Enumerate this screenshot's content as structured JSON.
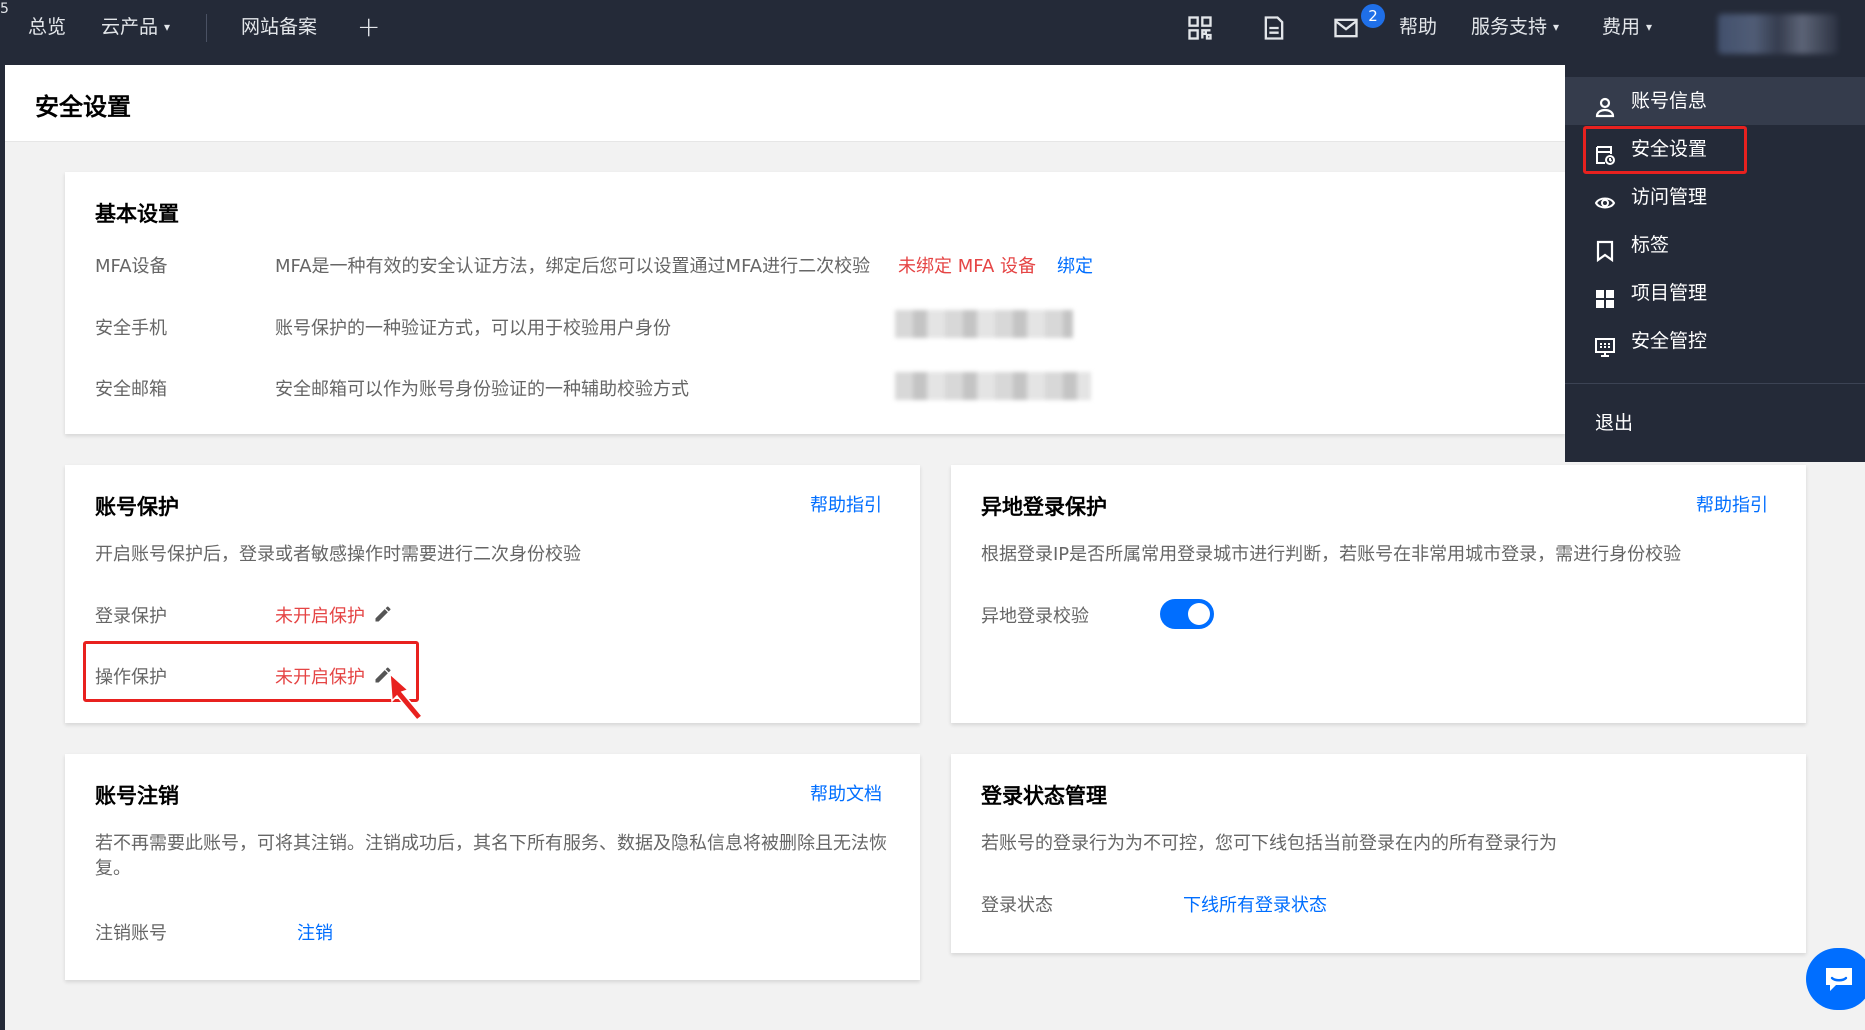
{
  "topbar": {
    "overview": "总览",
    "cloud_products": "云产品",
    "icp_filing": "网站备案",
    "add": "+",
    "message_count": "2",
    "help": "帮助",
    "service_support": "服务支持",
    "billing": "费用"
  },
  "page": {
    "title": "安全设置"
  },
  "basic_settings": {
    "title": "基本设置",
    "rows": [
      {
        "label": "MFA设备",
        "desc": "MFA是一种有效的安全认证方法，绑定后您可以设置通过MFA进行二次校验",
        "status": "未绑定 MFA 设备",
        "action": "绑定"
      },
      {
        "label": "安全手机",
        "desc": "账号保护的一种验证方式，可以用于校验用户身份"
      },
      {
        "label": "安全邮箱",
        "desc": "安全邮箱可以作为账号身份验证的一种辅助校验方式"
      }
    ]
  },
  "account_protection": {
    "title": "账号保护",
    "help_link": "帮助指引",
    "desc": "开启账号保护后，登录或者敏感操作时需要进行二次身份校验",
    "rows": [
      {
        "label": "登录保护",
        "status": "未开启保护"
      },
      {
        "label": "操作保护",
        "status": "未开启保护"
      }
    ]
  },
  "remote_login": {
    "title": "异地登录保护",
    "help_link": "帮助指引",
    "desc": "根据登录IP是否所属常用登录城市进行判断，若账号在非常用城市登录，需进行身份校验",
    "check_label": "异地登录校验",
    "enabled": true
  },
  "account_cancel": {
    "title": "账号注销",
    "help_link": "帮助文档",
    "desc_line1": "若不再需要此账号，可将其注销。注销成功后，其名下所有服务、数据及隐私信息将被删除且无法恢",
    "desc_line2": "复。",
    "label": "注销账号",
    "action": "注销"
  },
  "login_state": {
    "title": "登录状态管理",
    "desc": "若账号的登录行为为不可控，您可下线包括当前登录在内的所有登录行为",
    "label": "登录状态",
    "action": "下线所有登录状态"
  },
  "dropdown": {
    "items": [
      {
        "label": "账号信息",
        "icon": "user-icon"
      },
      {
        "label": "安全设置",
        "icon": "security-icon"
      },
      {
        "label": "访问管理",
        "icon": "access-icon"
      },
      {
        "label": "标签",
        "icon": "tag-icon"
      },
      {
        "label": "项目管理",
        "icon": "project-icon"
      },
      {
        "label": "安全管控",
        "icon": "security-control-icon"
      }
    ],
    "logout": "退出"
  },
  "colors": {
    "nav_bg": "#242a38",
    "link": "#006eff",
    "danger": "#e54545",
    "highlight": "#e8211f"
  }
}
